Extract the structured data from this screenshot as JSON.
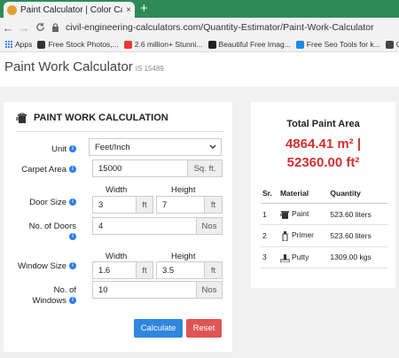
{
  "browser": {
    "tab_title": "Paint Calculator | Color Calculator",
    "tab_close": "×",
    "new_tab": "+",
    "back": "←",
    "forward": "→",
    "reload": "C",
    "url": "civil-engineering-calculators.com/Quantity-Estimator/Paint-Work-Calculator",
    "bookmarks": [
      "Apps",
      "Free Stock Photos,...",
      "2.6 million+ Stunni...",
      "Beautiful Free Imag...",
      "Free Seo Tools for k...",
      "QR"
    ]
  },
  "header": {
    "title": "Paint Work Calculator",
    "code": "IS 15489"
  },
  "form": {
    "heading": "PAINT WORK CALCULATION",
    "unit_label": "Unit",
    "unit_value": "Feet/Inch",
    "carpet_label": "Carpet Area",
    "carpet_value": "15000",
    "carpet_unit": "Sq. ft.",
    "width_header": "Width",
    "height_header": "Height",
    "door_size_label": "Door Size",
    "door_width": "3",
    "door_height": "7",
    "ft": "ft",
    "doors_label_1": "No. of Doors",
    "doors_value": "4",
    "nos": "Nos",
    "window_size_label": "Window Size",
    "window_width": "1.6",
    "window_height": "3.5",
    "windows_label_1": "No. of",
    "windows_label_2": "Windows",
    "windows_value": "10",
    "info_glyph": "i",
    "calculate": "Calculate",
    "reset": "Reset"
  },
  "results": {
    "title": "Total Paint Area",
    "area_m2": "4864.41 m² |",
    "area_ft2": "52360.00 ft²",
    "columns": [
      "Sr.",
      "Material",
      "Quantity"
    ],
    "rows": [
      {
        "sr": "1",
        "material": "Paint",
        "quantity": "523.60 liters",
        "icon": "paint-bucket-icon"
      },
      {
        "sr": "2",
        "material": "Primer",
        "quantity": "523.60 liters",
        "icon": "primer-bottle-icon"
      },
      {
        "sr": "3",
        "material": "Putty",
        "quantity": "1309.00 kgs",
        "icon": "putty-tray-icon"
      }
    ]
  },
  "colors": {
    "tabbar": "#2e8b57",
    "result_red": "#d32f2f",
    "calculate_blue": "#2e86de",
    "reset_red": "#e05454",
    "info_blue": "#2b7de9"
  }
}
